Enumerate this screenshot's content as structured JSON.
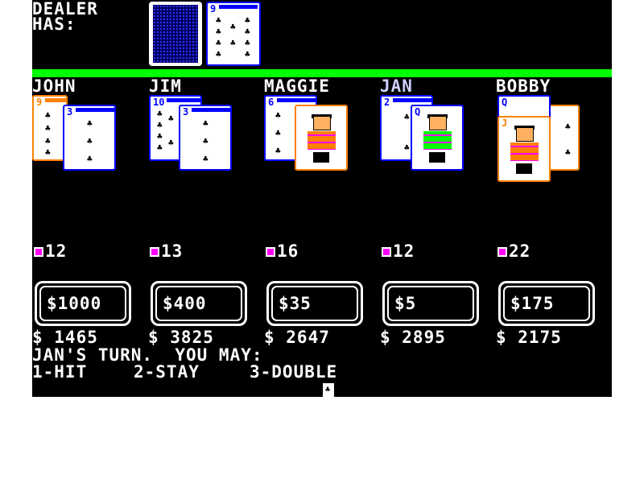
{
  "dealer": {
    "label_line1": "DEALER",
    "label_line2": "HAS:",
    "up_card": {
      "rank": "9",
      "suit": "club-icon"
    }
  },
  "players": [
    {
      "name": "JOHN",
      "total": "12",
      "bet": "$1000",
      "bankroll": "$ 1465",
      "cards": [
        {
          "rank": "9"
        },
        {
          "rank": "3"
        }
      ]
    },
    {
      "name": "JIM",
      "total": "13",
      "bet": "$400",
      "bankroll": "$ 3825",
      "cards": [
        {
          "rank": "10"
        },
        {
          "rank": "3"
        }
      ]
    },
    {
      "name": "MAGGIE",
      "total": "16",
      "bet": "$35",
      "bankroll": "$ 2647",
      "cards": [
        {
          "rank": "6"
        },
        {
          "rank": ""
        }
      ]
    },
    {
      "name": "JAN",
      "total": "12",
      "bet": "$5",
      "bankroll": "$ 2895",
      "cards": [
        {
          "rank": "2"
        },
        {
          "rank": "Q"
        }
      ]
    },
    {
      "name": "BOBBY",
      "total": "22",
      "bet": "$175",
      "bankroll": "$ 2175",
      "cards": [
        {
          "rank": "Q"
        },
        {
          "rank": "J"
        }
      ]
    }
  ],
  "prompt": {
    "turn_text": "JAN'S TURN.  YOU MAY:",
    "options": [
      "1-HIT",
      "2-STAY",
      "3-DOUBLE"
    ]
  },
  "colors": {
    "background": "#000000",
    "divider": "#00ff00",
    "card_blue": "#0000ff",
    "card_orange": "#ff8000",
    "accent_magenta": "#ff00ff"
  }
}
